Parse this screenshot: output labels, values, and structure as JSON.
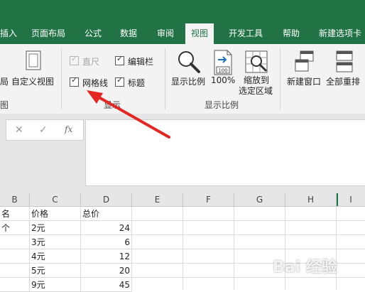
{
  "tabs": [
    {
      "label": "插入"
    },
    {
      "label": "页面布局"
    },
    {
      "label": "公式"
    },
    {
      "label": "数据"
    },
    {
      "label": "审阅"
    },
    {
      "label": "视图"
    },
    {
      "label": "开发工具"
    },
    {
      "label": "帮助"
    },
    {
      "label": "新建选项卡"
    }
  ],
  "active_tab": "视图",
  "ribbon": {
    "workbook_views": {
      "page_layout_partial": "局",
      "custom_views": "自定义视图",
      "group_label_partial": "图"
    },
    "show": {
      "ruler": {
        "label": "直尺",
        "checked": true,
        "enabled": false
      },
      "formula_bar": {
        "label": "编辑栏",
        "checked": true,
        "enabled": true
      },
      "gridlines": {
        "label": "网格线",
        "checked": true,
        "enabled": true
      },
      "headings": {
        "label": "标题",
        "checked": true,
        "enabled": true
      },
      "group_label": "显示"
    },
    "zoom": {
      "zoom_label": "显示比例",
      "zoom100_label": "100%",
      "zoom100_icon_text": "100",
      "zoom_selection_line1": "缩放到",
      "zoom_selection_line2": "选定区域",
      "group_label": "显示比例"
    },
    "window": {
      "new_window": "新建窗口",
      "arrange_all": "全部重排"
    }
  },
  "formula_bar": {
    "cancel": "✕",
    "enter": "✓",
    "fx": "fx",
    "value": ""
  },
  "columns": [
    "B",
    "C",
    "D",
    "E",
    "F",
    "G",
    "H",
    "I"
  ],
  "rows": [
    {
      "b": "名",
      "c": "价格",
      "d": "总价"
    },
    {
      "b": "个",
      "c": "2元",
      "d": "24"
    },
    {
      "b": "",
      "c": "3元",
      "d": "6"
    },
    {
      "b": "",
      "c": "4元",
      "d": "12"
    },
    {
      "b": "",
      "c": "5元",
      "d": "20"
    },
    {
      "b": "",
      "c": "9元",
      "d": "45"
    }
  ],
  "colors": {
    "excel_green": "#217346",
    "arrow_red": "#e52521"
  },
  "watermark": "Bai 经验"
}
